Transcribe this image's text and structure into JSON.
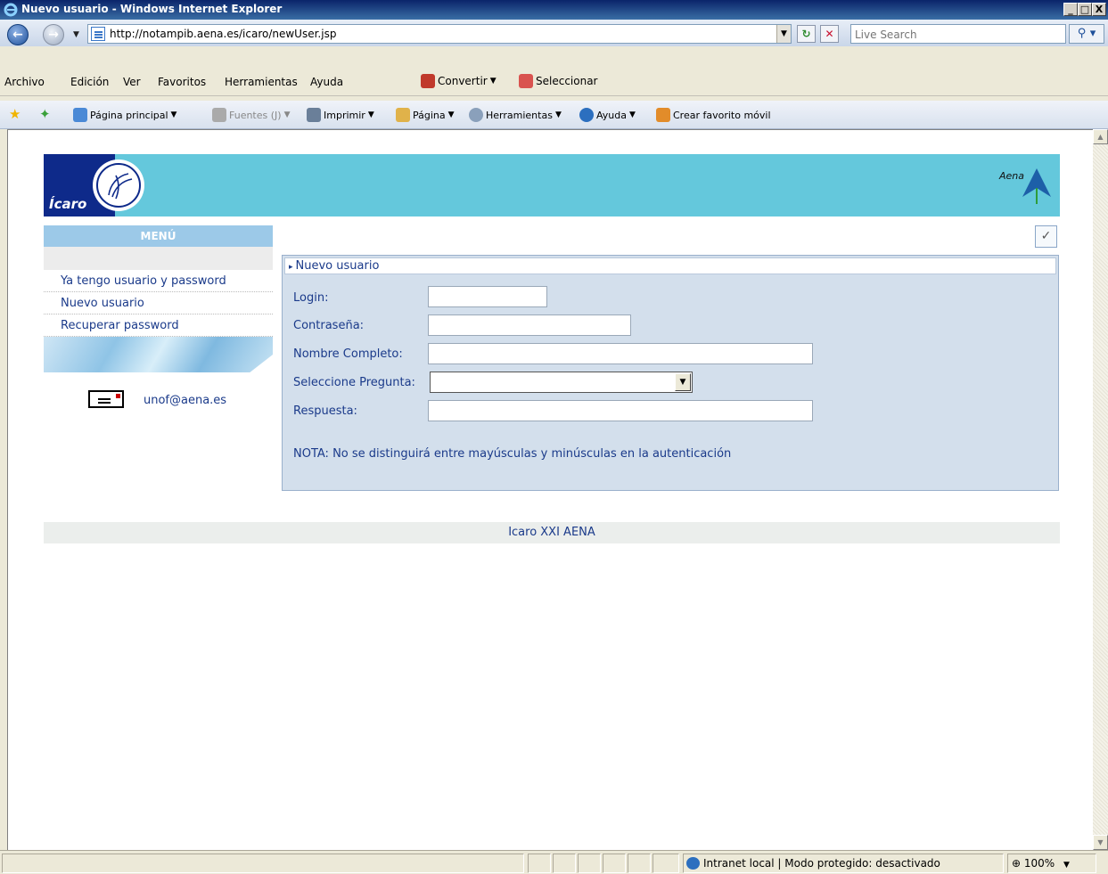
{
  "window": {
    "title": "Nuevo usuario - Windows Internet Explorer",
    "controls": [
      "_",
      "□",
      "X"
    ]
  },
  "addressbar": {
    "url": "http://notampib.aena.es/icaro/newUser.jsp",
    "search_placeholder": "Live Search"
  },
  "menubar": {
    "items": [
      "Archivo",
      "Edición",
      "Ver",
      "Favoritos",
      "Herramientas",
      "Ayuda"
    ],
    "convertir": "Convertir",
    "seleccionar": "Seleccionar"
  },
  "commandbar": {
    "home": "Página principal",
    "feeds": "Fuentes (J)",
    "print": "Imprimir",
    "page": "Página",
    "tools": "Herramientas",
    "help": "Ayuda",
    "mobile": "Crear favorito móvil"
  },
  "banner": {
    "logo_text": "Ícaro",
    "brand": "Aena"
  },
  "leftmenu": {
    "header": "MENÚ",
    "items": [
      "Ya tengo usuario y password",
      "Nuevo usuario",
      "Recuperar password"
    ],
    "email": "unof@aena.es"
  },
  "form": {
    "title": "Nuevo usuario",
    "login_label": "Login:",
    "password_label": "Contraseña:",
    "fullname_label": "Nombre Completo:",
    "question_label": "Seleccione Pregunta:",
    "answer_label": "Respuesta:",
    "note": "NOTA: No se distinguirá entre mayúsculas y minúsculas en la autenticación"
  },
  "footer": {
    "text": "Icaro XXI AENA"
  },
  "statusbar": {
    "zone": "Intranet local | Modo protegido: desactivado",
    "zoom": "100%"
  }
}
